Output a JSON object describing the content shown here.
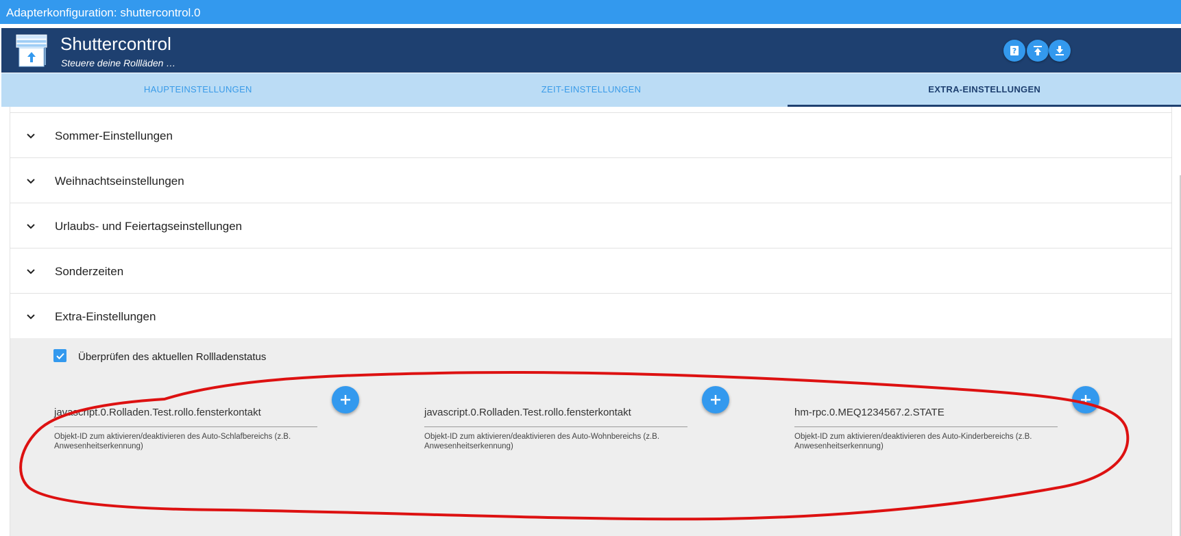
{
  "window": {
    "title": "Adapterkonfiguration: shuttercontrol.0"
  },
  "header": {
    "app_title": "Shuttercontrol",
    "app_subtitle": "Steuere deine Rollläden …",
    "buttons": [
      "help-icon",
      "upload-icon",
      "download-icon"
    ]
  },
  "tabs": [
    {
      "label": "HAUPTEINSTELLUNGEN",
      "active": false
    },
    {
      "label": "ZEIT-EINSTELLUNGEN",
      "active": false
    },
    {
      "label": "EXTRA-EINSTELLUNGEN",
      "active": true
    }
  ],
  "accordion": [
    {
      "label": "Sommer-Einstellungen"
    },
    {
      "label": "Weihnachtseinstellungen"
    },
    {
      "label": "Urlaubs- und Feiertagseinstellungen"
    },
    {
      "label": "Sonderzeiten"
    },
    {
      "label": "Extra-Einstellungen"
    }
  ],
  "extra": {
    "checkbox_label": "Überprüfen des aktuellen Rollladenstatus",
    "checkbox_checked": true,
    "fields": [
      {
        "value": "javascript.0.Rolladen.Test.rollo.fensterkontakt",
        "help": "Objekt-ID zum aktivieren/deaktivieren des Auto-Schlafbereichs (z.B. Anwesenheitserkennung)"
      },
      {
        "value": "javascript.0.Rolladen.Test.rollo.fensterkontakt",
        "help": "Objekt-ID zum aktivieren/deaktivieren des Auto-Wohnbereichs (z.B. Anwesenheitserkennung)"
      },
      {
        "value": "hm-rpc.0.MEQ1234567.2.STATE",
        "help": "Objekt-ID zum aktivieren/deaktivieren des Auto-Kinderbereichs (z.B. Anwesenheitserkennung)"
      }
    ]
  },
  "colors": {
    "titlebar": "#3399ee",
    "header": "#1e4070",
    "tabbar": "#bbdcf5",
    "accent": "#3399ee",
    "annotation": "#dd1111"
  }
}
